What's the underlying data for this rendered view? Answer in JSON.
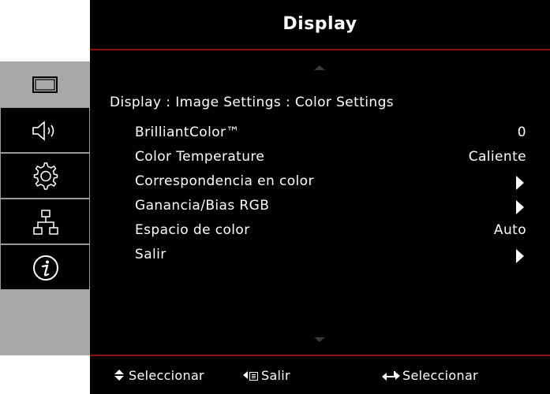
{
  "header": {
    "title": "Display"
  },
  "breadcrumb": "Display : Image Settings : Color Settings",
  "sidebar": {
    "tabs": [
      {
        "icon": "display-icon",
        "active": true
      },
      {
        "icon": "speaker-icon",
        "active": false
      },
      {
        "icon": "gear-icon",
        "active": false
      },
      {
        "icon": "network-icon",
        "active": false
      },
      {
        "icon": "info-icon",
        "active": false
      }
    ]
  },
  "menu": {
    "items": [
      {
        "label": "BrilliantColor™",
        "value": "0",
        "type": "value"
      },
      {
        "label": "Color Temperature",
        "value": "Caliente",
        "type": "value"
      },
      {
        "label": "Correspondencia en color",
        "value": "",
        "type": "submenu"
      },
      {
        "label": "Ganancia/Bias RGB",
        "value": "",
        "type": "submenu"
      },
      {
        "label": "Espacio de color",
        "value": "Auto",
        "type": "value"
      },
      {
        "label": "Salir",
        "value": "",
        "type": "submenu"
      }
    ]
  },
  "footer": {
    "hint_select": "Seleccionar",
    "hint_exit": "Salir",
    "hint_enter": "Seleccionar"
  },
  "colors": {
    "accent_line": "#8a1010",
    "sidebar_active": "#a8a8a8",
    "background": "#000000"
  }
}
